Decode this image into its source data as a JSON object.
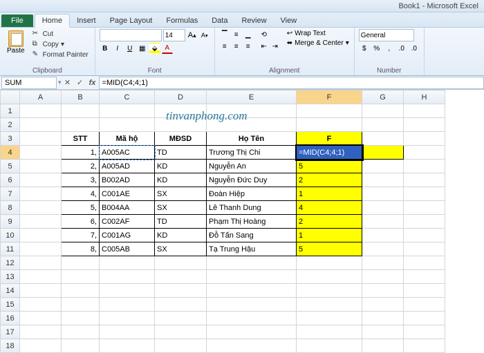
{
  "title": "Book1 - Microsoft Excel",
  "tabs": {
    "file": "File",
    "home": "Home",
    "insert": "Insert",
    "pagelayout": "Page Layout",
    "formulas": "Formulas",
    "data": "Data",
    "review": "Review",
    "view": "View"
  },
  "clipboard": {
    "paste": "Paste",
    "cut": "Cut",
    "copy": "Copy",
    "painter": "Format Painter",
    "label": "Clipboard"
  },
  "font": {
    "size": "14",
    "grow": "A",
    "shrink": "A",
    "bold": "B",
    "italic": "I",
    "underline": "U",
    "label": "Font"
  },
  "align": {
    "wrap": "Wrap Text",
    "merge": "Merge & Center",
    "label": "Alignment"
  },
  "number": {
    "format": "General",
    "label": "Number"
  },
  "formula": {
    "namebox": "SUM",
    "cancel": "✕",
    "enter": "✓",
    "fx": "fx",
    "value": "=MID(C4;4;1)"
  },
  "watermark": "tinvanphong.com",
  "cols": [
    "A",
    "B",
    "C",
    "D",
    "E",
    "F",
    "G",
    "H"
  ],
  "headers": {
    "b": "STT",
    "c": "Mã hộ",
    "d": "MĐSD",
    "e": "Họ Tên",
    "f": "F"
  },
  "rows": [
    {
      "stt": "1,",
      "ma": "A005AC",
      "md": "TD",
      "ten": "Trương Thị Chi",
      "f": "=MID(C4;4;1)"
    },
    {
      "stt": "2,",
      "ma": "A005AD",
      "md": "KD",
      "ten": "Nguyễn An",
      "f": "5"
    },
    {
      "stt": "3,",
      "ma": "B002AD",
      "md": "KD",
      "ten": "Nguyễn Đức Duy",
      "f": "2"
    },
    {
      "stt": "4,",
      "ma": "C001AE",
      "md": "SX",
      "ten": "Đoàn Hiệp",
      "f": "1"
    },
    {
      "stt": "5,",
      "ma": "B004AA",
      "md": "SX",
      "ten": "Lê Thanh Dung",
      "f": "4"
    },
    {
      "stt": "6,",
      "ma": "C002AF",
      "md": "TD",
      "ten": "Phạm Thị Hoàng",
      "f": "2"
    },
    {
      "stt": "7,",
      "ma": "C001AG",
      "md": "KD",
      "ten": "Đỗ Tấn Sang",
      "f": "1"
    },
    {
      "stt": "8,",
      "ma": "C005AB",
      "md": "SX",
      "ten": "Tạ Trung Hậu",
      "f": "5"
    }
  ]
}
